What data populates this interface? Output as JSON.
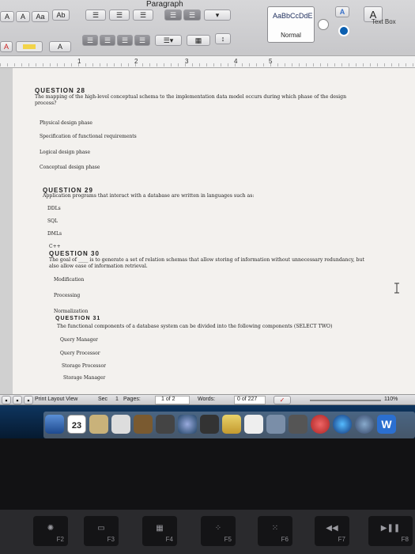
{
  "ribbon": {
    "group_label": "Paragraph",
    "font_grow": "A",
    "font_shrink": "A",
    "change_case": "Aa",
    "clear_format": "Ab",
    "highlight": "A",
    "font_color": "A",
    "style_sample": "AaBbCcDdE",
    "style_name": "Normal",
    "text_box_label": "Text Box"
  },
  "ruler": {
    "numbers": [
      "1",
      "2",
      "3",
      "4",
      "5"
    ]
  },
  "document": {
    "questions": [
      {
        "heading": "QUESTION 28",
        "text": "The mapping of the high-level conceptual schema to the implementation data model occurs during which phase of the design process?",
        "options": [
          "Physical design phase",
          "Specification of functional requirements",
          "Logical design phase",
          "Conceptual design phase"
        ]
      },
      {
        "heading": "QUESTION 29",
        "text": "Application programs that interact with a database are written in languages such as:",
        "options": [
          "DDLs",
          "SQL",
          "DMLs",
          "C++"
        ]
      },
      {
        "heading": "QUESTION 30",
        "text": "The goal of ____ is to generate a set of relation schemas that allow storing of information without unnecessary redundancy, but also allow ease of information retrieval.",
        "options": [
          "Modification",
          "Processing",
          "Normalization"
        ]
      },
      {
        "heading": "QUESTION 31",
        "text": "The functional components of a database system can be divided into the following components (SELECT TWO)",
        "options": [
          "Query Manager",
          "Query Processor",
          "Storage Processor",
          "Storage Manager"
        ]
      }
    ]
  },
  "status_bar": {
    "view": "Print Layout View",
    "sec_label": "Sec",
    "sec_value": "1",
    "pages_label": "Pages:",
    "pages_value": "1 of 2",
    "words_label": "Words:",
    "words_value": "0 of 227",
    "zoom": "110%"
  },
  "dock": {
    "calendar_day": "23"
  },
  "keyboard": {
    "keys": [
      "F2",
      "F3",
      "F4",
      "F5",
      "F6",
      "F7",
      "F8"
    ]
  }
}
